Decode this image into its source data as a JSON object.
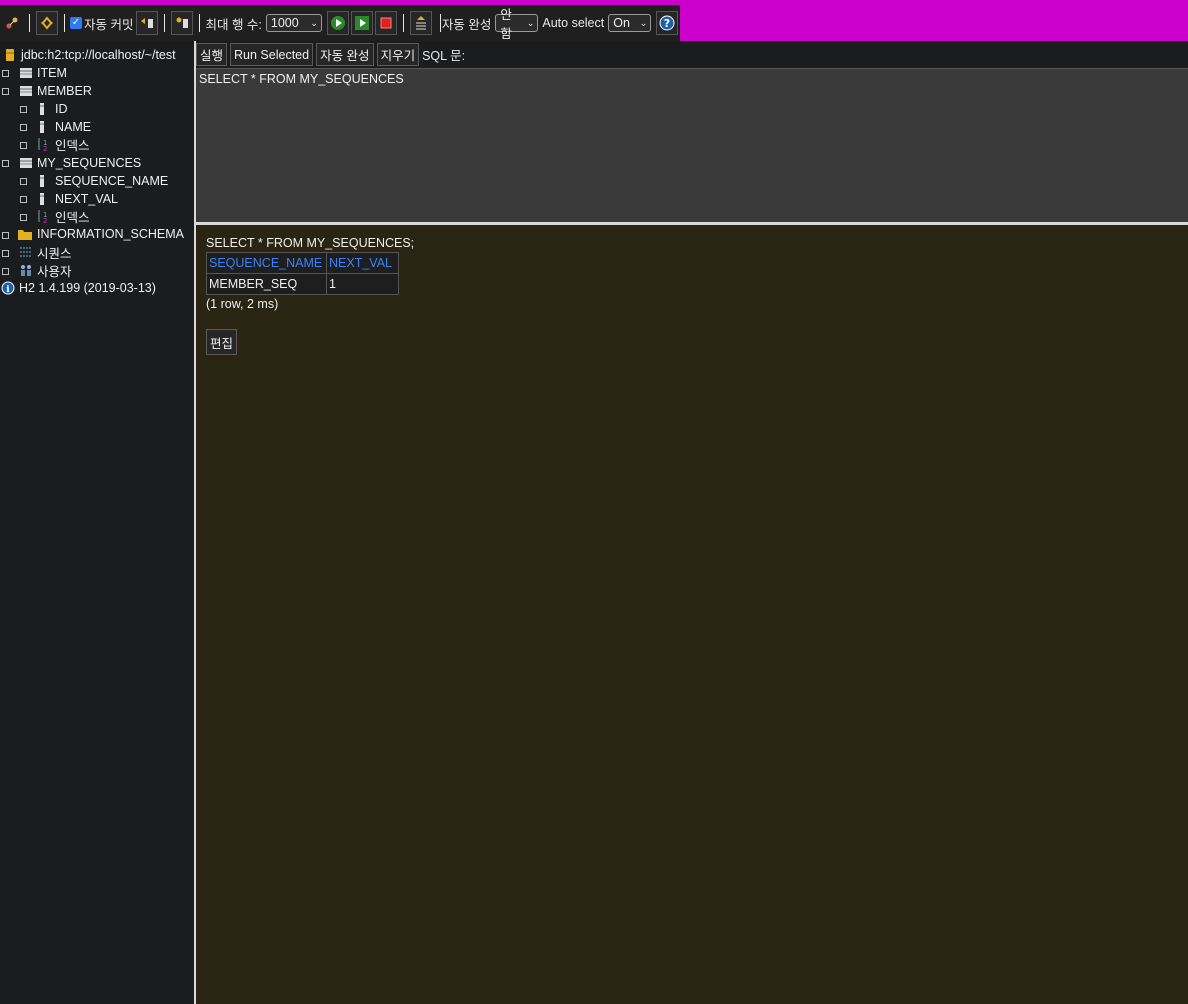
{
  "toolbar": {
    "autocommit_label": "자동 커밋",
    "autocommit_checked": true,
    "max_rows_label": "최대 행 수:",
    "max_rows_value": "1000",
    "autocomplete_label": "자동 완성",
    "autocomplete_value": "안함",
    "autoselect_label": "Auto select",
    "autoselect_value": "On",
    "accent_color": "#cc00cc"
  },
  "sidebar": {
    "connection": "jdbc:h2:tcp://localhost/~/test",
    "items": [
      {
        "label": "ITEM",
        "icon": "table-icon"
      },
      {
        "label": "MEMBER",
        "icon": "table-icon"
      },
      {
        "label": "ID",
        "icon": "column-icon"
      },
      {
        "label": "NAME",
        "icon": "column-icon"
      },
      {
        "label": "인덱스",
        "icon": "index-icon"
      },
      {
        "label": "MY_SEQUENCES",
        "icon": "table-icon"
      },
      {
        "label": "SEQUENCE_NAME",
        "icon": "column-icon"
      },
      {
        "label": "NEXT_VAL",
        "icon": "column-icon"
      },
      {
        "label": "인덱스",
        "icon": "index-icon"
      },
      {
        "label": "INFORMATION_SCHEMA",
        "icon": "folder-icon"
      },
      {
        "label": "시퀀스",
        "icon": "sequence-icon"
      },
      {
        "label": "사용자",
        "icon": "users-icon"
      }
    ],
    "version": "H2 1.4.199 (2019-03-13)"
  },
  "query_bar": {
    "run": "실행",
    "run_selected": "Run Selected",
    "autocomplete": "자동 완성",
    "clear": "지우기",
    "sql_label": "SQL 문:"
  },
  "editor": {
    "sql": "SELECT * FROM MY_SEQUENCES"
  },
  "results": {
    "query": "SELECT * FROM MY_SEQUENCES;",
    "columns": [
      "SEQUENCE_NAME",
      "NEXT_VAL"
    ],
    "rows": [
      [
        "MEMBER_SEQ",
        "1"
      ]
    ],
    "footer": "(1 row, 2 ms)",
    "edit_button": "편집"
  }
}
